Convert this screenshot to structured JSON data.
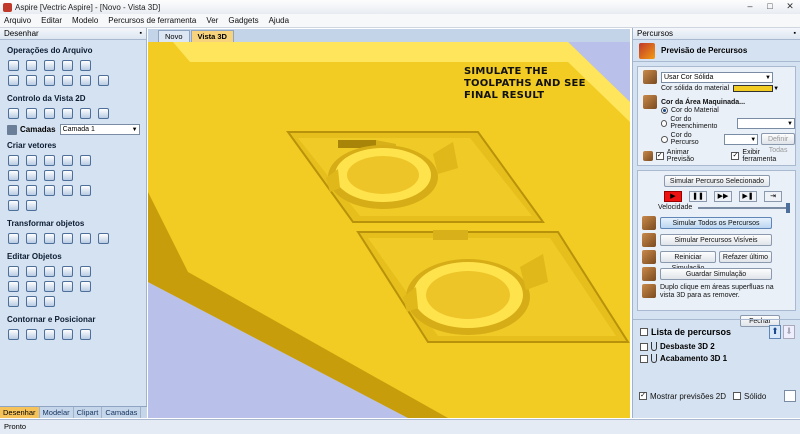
{
  "window": {
    "title": "Aspire [Vectric Aspire] - [Novo - Vista 3D]",
    "controls": [
      "–",
      "□",
      "✕"
    ]
  },
  "menu": [
    "Arquivo",
    "Editar",
    "Modelo",
    "Percursos de ferramenta",
    "Ver",
    "Gadgets",
    "Ajuda"
  ],
  "left": {
    "header": "Desenhar",
    "sections": {
      "file_ops": "Operações do Arquivo",
      "view_ctrl": "Controlo da Vista 2D",
      "create_vectors": "Criar vetores",
      "transform": "Transformar objetos",
      "edit": "Editar Objetos",
      "offset": "Contornar e Posicionar"
    },
    "layers_label": "Camadas",
    "layer_value": "Camada 1",
    "tabs": [
      "Desenhar",
      "Modelar",
      "Clipart",
      "Camadas"
    ]
  },
  "doc": {
    "tabs": [
      "Novo",
      "Vista 3D"
    ],
    "overlay": [
      "SIMULATE THE",
      "TOOLPATHS AND SEE",
      "FINAL RESULT"
    ]
  },
  "right": {
    "header": "Percursos",
    "title": "Previsão de Percursos",
    "color_mode": "Usar Cor Sólida",
    "material_color_label": "Cor sólida do material",
    "material_color": "#f2cc22",
    "machined_area_label": "Cor da Área Maquinada...",
    "radio": [
      "Cor do Material",
      "Cor do Preenchimento",
      "Cor do Percurso"
    ],
    "define_all": "Definir Todas",
    "animate_label": "Animar Previsão",
    "show_tool_label": "Exibir ferramenta",
    "simulate_selected": "Simular Percurso Selecionado",
    "speed_label": "Velocidade",
    "simulate_all": "Simular Todos os Percursos",
    "simulate_visible": "Simular Percursos Visíveis",
    "reset_sim": "Reiniciar Simulação",
    "redo_last": "Refazer último",
    "save_sim": "Guardar Simulação",
    "hint": "Duplo clique em áreas superfluas na vista 3D para as remover.",
    "close": "Fechar",
    "list_title": "Lista de percursos",
    "toolpaths": [
      "Desbaste 3D 2",
      "Acabamento 3D 1"
    ],
    "show_2d": "Mostrar previsões 2D",
    "solid": "Sólido"
  },
  "status": "Pronto"
}
